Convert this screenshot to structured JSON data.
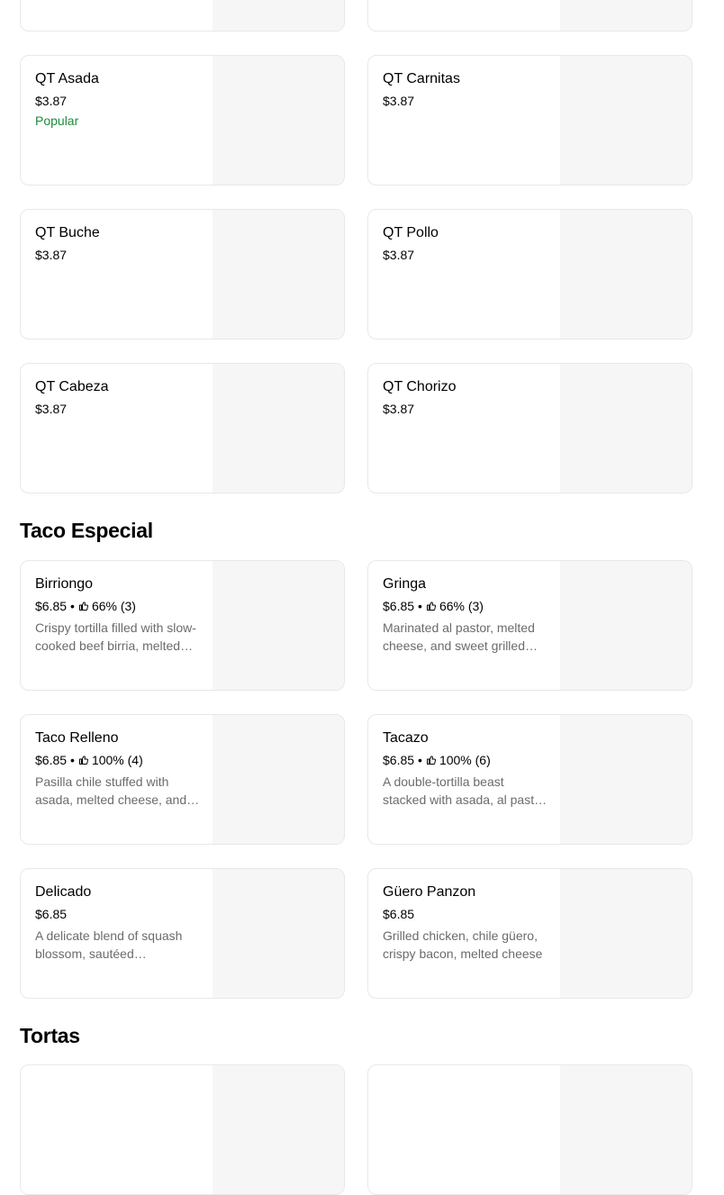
{
  "colors": {
    "card_border": "#e8e8e8",
    "image_placeholder": "#f6f6f6",
    "popular_green": "#1e8a3e",
    "description_gray": "#6b6b6b"
  },
  "icons": {
    "rating": "thumbs-up-icon"
  },
  "quesotacos": {
    "items": [
      {
        "name": "QT Asada",
        "price": "$3.87",
        "badge": "Popular"
      },
      {
        "name": "QT Carnitas",
        "price": "$3.87"
      },
      {
        "name": "QT Buche",
        "price": "$3.87"
      },
      {
        "name": "QT Pollo",
        "price": "$3.87"
      },
      {
        "name": "QT Cabeza",
        "price": "$3.87"
      },
      {
        "name": "QT Chorizo",
        "price": "$3.87"
      }
    ]
  },
  "taco_especial": {
    "title": "Taco Especial",
    "items": [
      {
        "name": "Birriongo",
        "price": "$6.85",
        "separator": "•",
        "rating": "66% (3)",
        "description": "Crispy tortilla filled with slow-cooked beef birria, melted cheese and consommé"
      },
      {
        "name": "Gringa",
        "price": "$6.85",
        "separator": "•",
        "rating": "66% (3)",
        "description": "Marinated al pastor, melted cheese, and sweet grilled pineapple"
      },
      {
        "name": "Taco Relleno",
        "price": "$6.85",
        "separator": "•",
        "rating": "100% (4)",
        "description": "Pasilla chile stuffed with asada, melted cheese, and onions"
      },
      {
        "name": "Tacazo",
        "price": "$6.85",
        "separator": "•",
        "rating": "100% (6)",
        "description": "A double-tortilla beast stacked with asada, al pastor and cheese"
      },
      {
        "name": "Delicado",
        "price": "$6.85",
        "description": "A delicate blend of squash blossom, sautéed mushrooms and cheese"
      },
      {
        "name": "Güero Panzon",
        "price": "$6.85",
        "description": "Grilled chicken, chile güero, crispy bacon, melted cheese"
      }
    ]
  },
  "tortas": {
    "title": "Tortas"
  }
}
